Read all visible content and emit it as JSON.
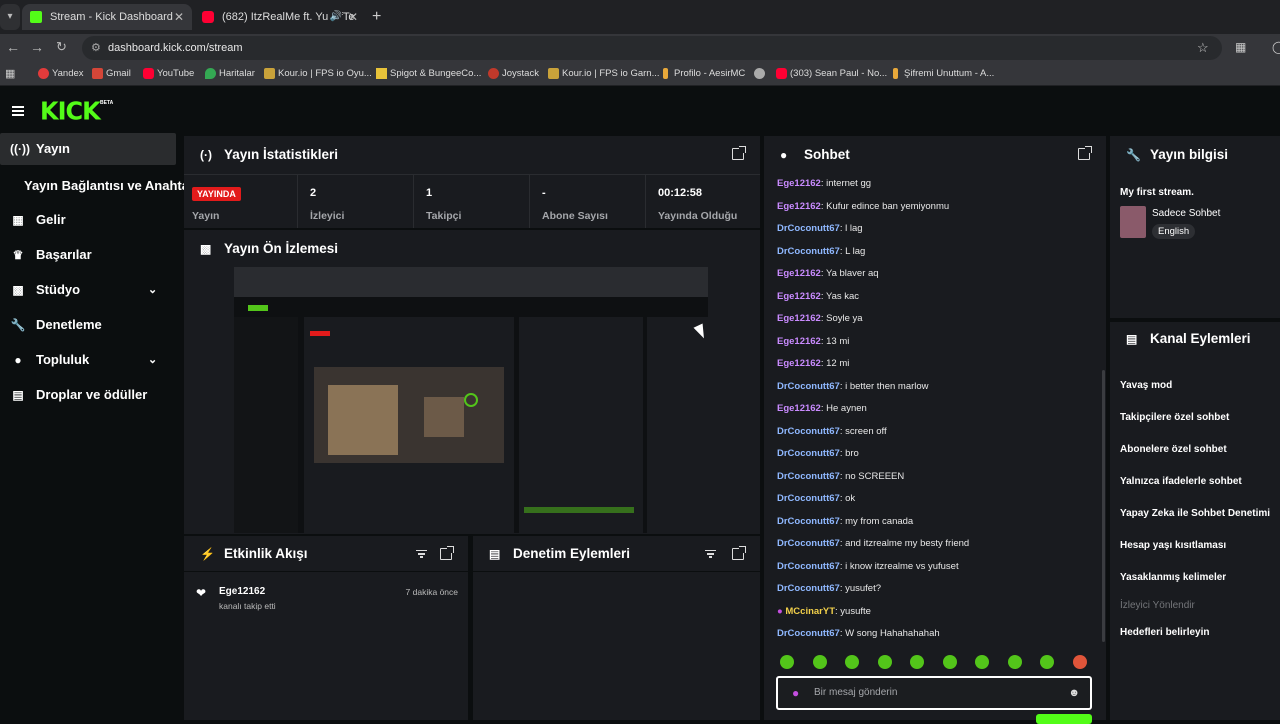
{
  "browser": {
    "tabs": [
      {
        "title": "Stream - Kick Dashboard"
      },
      {
        "title": "(682) ItzRealMe ft. YusufTe"
      }
    ],
    "url": "dashboard.kick.com/stream",
    "bookmarks": [
      "Yandex",
      "Gmail",
      "YouTube",
      "Haritalar",
      "Kour.io | FPS io Oyu...",
      "Spigot & BungeeCo...",
      "Joystack",
      "Kour.io | FPS io Garn...",
      "Profilo - AesirMC",
      "(303) Sean Paul - No...",
      "Şifremi Unuttum - A..."
    ]
  },
  "brand": {
    "logo": "KICK",
    "badge": "BETA",
    "accent": "#53fc18"
  },
  "sidebar": {
    "items": [
      {
        "label": "Yayın",
        "icon": "broadcast-icon"
      },
      {
        "label": "Yayın Bağlantısı ve Anahtarı"
      },
      {
        "label": "Gelir",
        "icon": "chart-icon"
      },
      {
        "label": "Başarılar",
        "icon": "trophy-icon"
      },
      {
        "label": "Stüdyo",
        "icon": "studio-icon"
      },
      {
        "label": "Denetleme",
        "icon": "wrench-icon"
      },
      {
        "label": "Topluluk",
        "icon": "community-icon"
      },
      {
        "label": "Droplar ve ödüller",
        "icon": "gift-icon"
      }
    ]
  },
  "stats_panel": {
    "title": "Yayın İstatistikleri",
    "live_badge": "YAYINDA",
    "live_label": "Yayın",
    "stats": [
      {
        "value": "2",
        "label": "İzleyici"
      },
      {
        "value": "1",
        "label": "Takipçi"
      },
      {
        "value": "-",
        "label": "Abone Sayısı"
      },
      {
        "value": "00:12:58",
        "label": "Yayında Olduğu"
      }
    ]
  },
  "preview_panel": {
    "title": "Yayın Ön İzlemesi"
  },
  "chat": {
    "title": "Sohbet",
    "messages": [
      {
        "user": "Ege12162",
        "text": "internet gg",
        "color": "#c98bff"
      },
      {
        "user": "Ege12162",
        "text": "Kufur edince ban yemiyonmu",
        "color": "#c98bff"
      },
      {
        "user": "DrCoconutt67",
        "text": "l lag",
        "color": "#8fb8ff"
      },
      {
        "user": "DrCoconutt67",
        "text": "L lag",
        "color": "#8fb8ff"
      },
      {
        "user": "Ege12162",
        "text": "Ya blaver aq",
        "color": "#c98bff"
      },
      {
        "user": "Ege12162",
        "text": "Yas kac",
        "color": "#c98bff"
      },
      {
        "user": "Ege12162",
        "text": "Soyle ya",
        "color": "#c98bff"
      },
      {
        "user": "Ege12162",
        "text": "13 mi",
        "color": "#c98bff"
      },
      {
        "user": "Ege12162",
        "text": "12 mi",
        "color": "#c98bff"
      },
      {
        "user": "DrCoconutt67",
        "text": "i better then marlow",
        "color": "#8fb8ff"
      },
      {
        "user": "Ege12162",
        "text": "He aynen",
        "color": "#c98bff"
      },
      {
        "user": "DrCoconutt67",
        "text": "screen off",
        "color": "#8fb8ff"
      },
      {
        "user": "DrCoconutt67",
        "text": "bro",
        "color": "#8fb8ff"
      },
      {
        "user": "DrCoconutt67",
        "text": "no SCREEEN",
        "color": "#8fb8ff"
      },
      {
        "user": "DrCoconutt67",
        "text": "ok",
        "color": "#8fb8ff"
      },
      {
        "user": "DrCoconutt67",
        "text": "my from canada",
        "color": "#8fb8ff"
      },
      {
        "user": "DrCoconutt67",
        "text": "and itzrealme my besty friend",
        "color": "#8fb8ff"
      },
      {
        "user": "DrCoconutt67",
        "text": "i know itzrealme vs yufuset",
        "color": "#8fb8ff"
      },
      {
        "user": "DrCoconutt67",
        "text": "yusufet?",
        "color": "#8fb8ff"
      },
      {
        "user": "MCcinarYT",
        "text": "yusufte",
        "color": "#f2d04a"
      },
      {
        "user": "DrCoconutt67",
        "text": "W song Hahahahahah",
        "color": "#8fb8ff"
      }
    ],
    "input_placeholder": "Bir mesaj gönderin"
  },
  "info_panel": {
    "title": "Yayın bilgisi",
    "stream_title": "My first stream.",
    "category": "Sadece Sohbet",
    "language": "English"
  },
  "channel_actions": {
    "title": "Kanal Eylemleri",
    "items": [
      {
        "label": "Yavaş mod",
        "enabled": true
      },
      {
        "label": "Takipçilere özel sohbet",
        "enabled": true
      },
      {
        "label": "Abonelere özel sohbet",
        "enabled": true
      },
      {
        "label": "Yalnızca ifadelerle sohbet",
        "enabled": true
      },
      {
        "label": "Yapay Zeka ile Sohbet Denetimi",
        "enabled": true
      },
      {
        "label": "Hesap yaşı kısıtlaması",
        "enabled": true
      },
      {
        "label": "Yasaklanmış kelimeler",
        "enabled": true
      },
      {
        "label": "İzleyici Yönlendir",
        "enabled": false
      },
      {
        "label": "Hedefleri belirleyin",
        "enabled": true
      }
    ]
  },
  "activity_feed": {
    "title": "Etkinlik Akışı",
    "events": [
      {
        "user": "Ege12162",
        "action": "kanalı takip etti",
        "time": "7 dakika önce"
      }
    ]
  },
  "mod_actions": {
    "title": "Denetim Eylemleri"
  }
}
